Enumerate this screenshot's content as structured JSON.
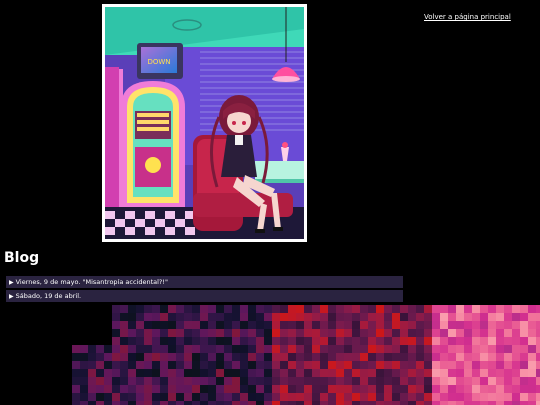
{
  "header": {
    "back_link": "Volver a página principal"
  },
  "hero": {
    "tv_sign": "DOWN"
  },
  "blog": {
    "title": "Blog",
    "entries": [
      {
        "label": "Viernes, 9 de mayo. \"Misantropía accidental?!\""
      },
      {
        "label": "Sábado, 19 de abril."
      }
    ]
  },
  "icons": {
    "collapsed": "triangle-right-icon"
  },
  "colors": {
    "background": "#000000",
    "entry_bg": "#2a2340",
    "text": "#ffffff",
    "image_border": "#ffffff"
  }
}
